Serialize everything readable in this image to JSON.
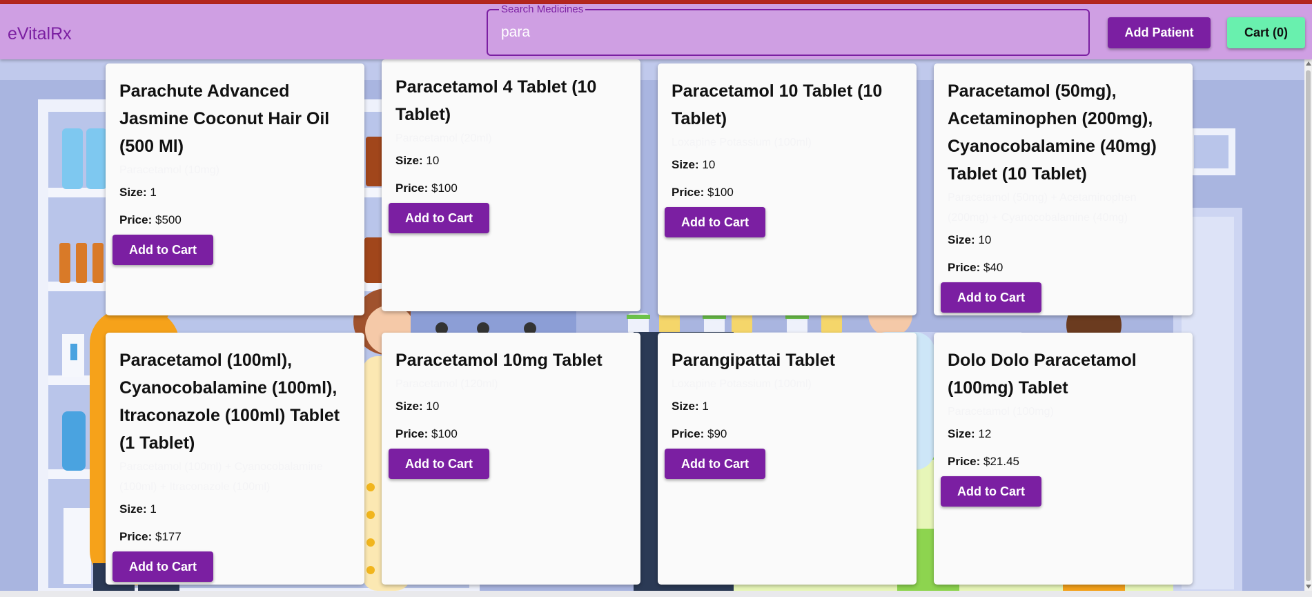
{
  "app": {
    "title": "eVitalRx"
  },
  "search": {
    "label": "Search Medicines",
    "value": "para"
  },
  "header_buttons": {
    "add_patient": "Add Patient",
    "cart": "Cart (0)"
  },
  "labels": {
    "size": "Size:",
    "price": "Price:",
    "add_to_cart": "Add to Cart"
  },
  "products": [
    {
      "name": "Parachute Advanced Jasmine Coconut Hair Oil (500 Ml)",
      "composition": "Paracetamol (10mg)",
      "size": "1",
      "price": "$500"
    },
    {
      "name": "Paracetamol 4 Tablet (10 Tablet)",
      "composition": "Paracetamol (20ml)",
      "size": "10",
      "price": "$100"
    },
    {
      "name": "Paracetamol 10 Tablet (10 Tablet)",
      "composition": "Loxapine Potassium (100ml)",
      "size": "10",
      "price": "$100"
    },
    {
      "name": "Paracetamol (50mg), Acetaminophen (200mg), Cyanocobalamine (40mg) Tablet (10 Tablet)",
      "composition": "Paracetamol (50mg) + Acetaminophen (200mg) + Cyanocobalamine (40mg)",
      "size": "10",
      "price": "$40"
    },
    {
      "name": "Paracetamol (100ml), Cyanocobalamine (100ml), Itraconazole (100ml) Tablet (1 Tablet)",
      "composition": "Paracetamol (100ml) + Cyanocobalamine (100ml) + Itraconazole (100ml)",
      "size": "1",
      "price": "$177"
    },
    {
      "name": "Paracetamol 10mg Tablet",
      "composition": "Paracetamol (120ml)",
      "size": "10",
      "price": "$100"
    },
    {
      "name": "Parangipattai Tablet",
      "composition": "Loxapine Potassium (100ml)",
      "size": "1",
      "price": "$90"
    },
    {
      "name": "Dolo Dolo Paracetamol (100mg) Tablet",
      "composition": "Paracetamol (100mg)",
      "size": "12",
      "price": "$21.45"
    }
  ],
  "colors": {
    "header_bg": "#cf9fe3",
    "primary": "#7b1fa2",
    "cart_button": "#69f0ae",
    "card_bg": "#fafafa",
    "top_strip": "#b3261e"
  }
}
